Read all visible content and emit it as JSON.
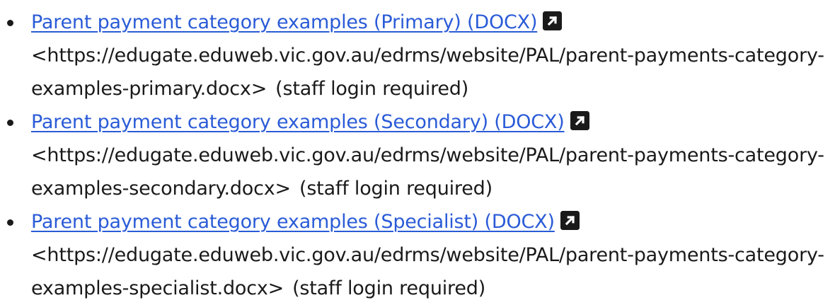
{
  "items": [
    {
      "link_text": "Parent payment category examples (Primary) (DOCX)",
      "url_text": "<https://edugate.eduweb.vic.gov.au/edrms/website/PAL/parent-payments-category-examples-primary.docx>",
      "note": "(staff login required)",
      "icon": "external-link-icon"
    },
    {
      "link_text": "Parent payment category examples (Secondary) (DOCX)",
      "url_text": "<https://edugate.eduweb.vic.gov.au/edrms/website/PAL/parent-payments-category-examples-secondary.docx>",
      "note": "(staff login required)",
      "icon": "external-link-icon"
    },
    {
      "link_text": "Parent payment category examples (Specialist) (DOCX)",
      "url_text": "<https://edugate.eduweb.vic.gov.au/edrms/website/PAL/parent-payments-category-examples-specialist.docx>",
      "note": "(staff login required)",
      "icon": "external-link-icon"
    }
  ],
  "colors": {
    "link": "#2a5bd7",
    "text": "#1a1a1a",
    "icon_bg": "#1a1a1a"
  }
}
